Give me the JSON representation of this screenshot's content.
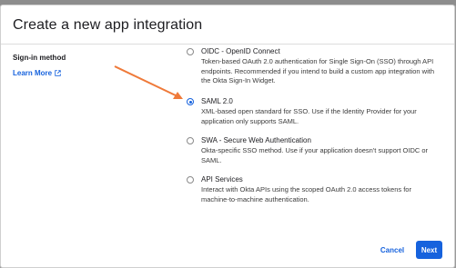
{
  "modal": {
    "title": "Create a new app integration",
    "field_label": "Sign-in method",
    "learn_more": "Learn More",
    "options": [
      {
        "title": "OIDC - OpenID Connect",
        "description": "Token-based OAuth 2.0 authentication for Single Sign-On (SSO) through API endpoints. Recommended if you intend to build a custom app integration with the Okta Sign-In Widget.",
        "selected": false
      },
      {
        "title": "SAML 2.0",
        "description": "XML-based open standard for SSO. Use if the Identity Provider for your application only supports SAML.",
        "selected": true
      },
      {
        "title": "SWA - Secure Web Authentication",
        "description": "Okta-specific SSO method. Use if your application doesn't support OIDC or SAML.",
        "selected": false
      },
      {
        "title": "API Services",
        "description": "Interact with Okta APIs using the scoped OAuth 2.0 access tokens for machine-to-machine authentication.",
        "selected": false
      }
    ],
    "cancel_label": "Cancel",
    "next_label": "Next"
  },
  "colors": {
    "accent": "#1662dd",
    "annotation_arrow": "#ef7a3a"
  },
  "icons": {
    "learn_more": "external-link-icon"
  }
}
